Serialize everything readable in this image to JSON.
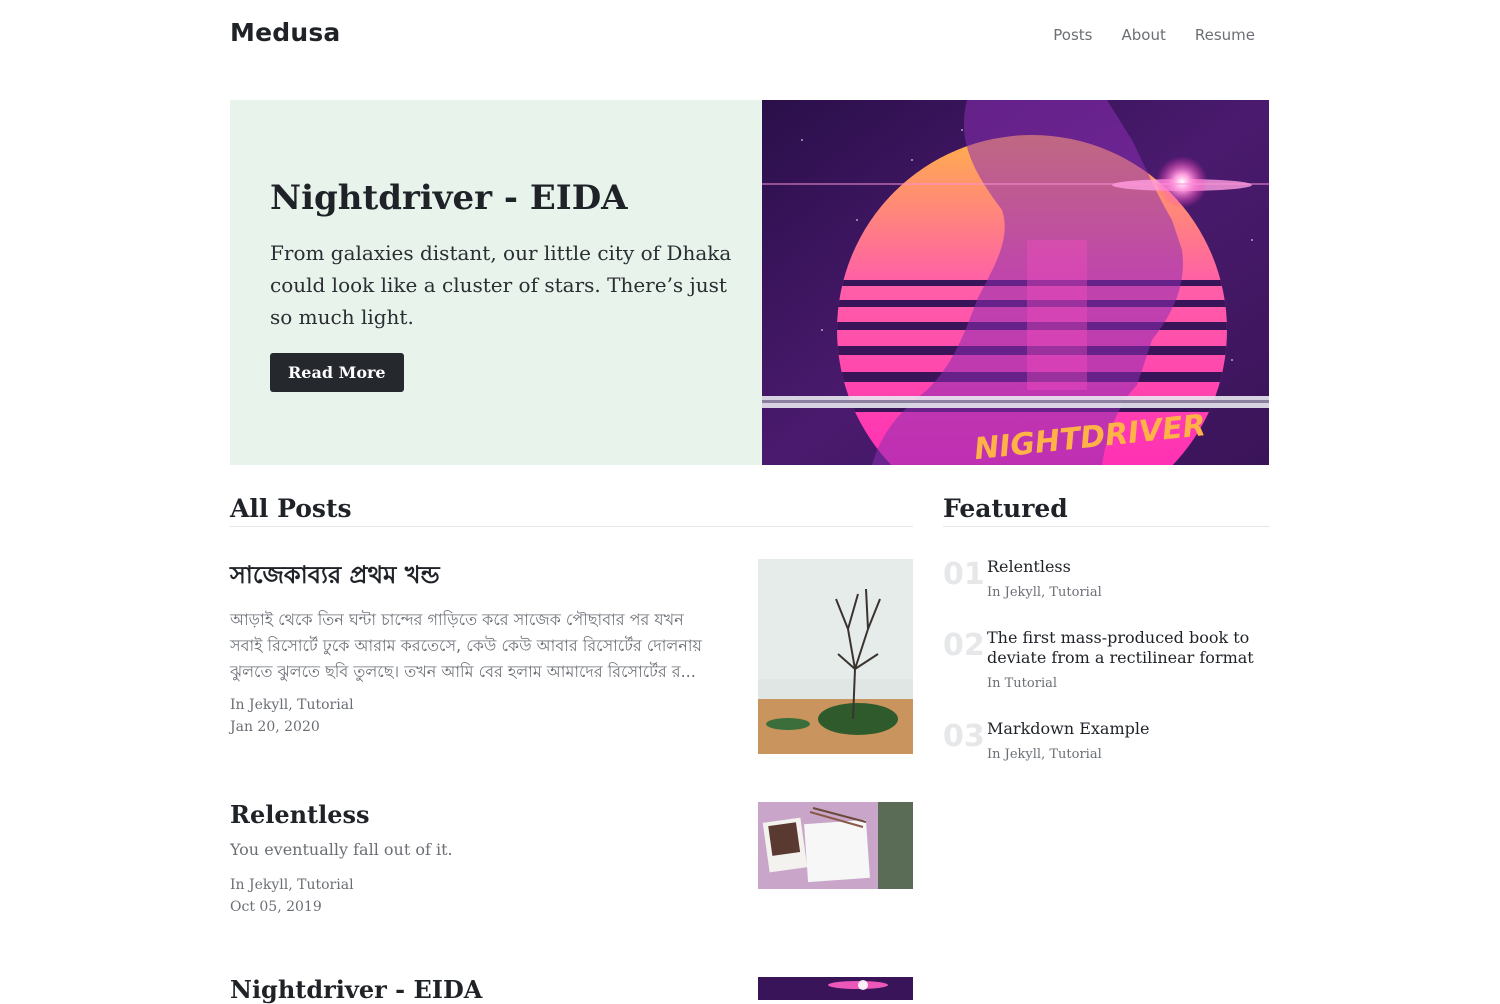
{
  "header": {
    "brand": "Medusa",
    "nav": [
      "Posts",
      "About",
      "Resume"
    ]
  },
  "hero": {
    "title": "Nightdriver - EIDA",
    "excerpt": "From galaxies distant, our little city of Dhaka could look like a cluster of stars. There’s just so much light.",
    "button": "Read More",
    "image_text": "NIGHTDRIVER"
  },
  "all_posts": {
    "heading": "All Posts",
    "posts": [
      {
        "title": "সাজেকাব্যর প্রথম খন্ড",
        "excerpt": "আড়াই থেকে তিন ঘন্টা চান্দের গাড়িতে করে সাজেক পৌছাবার পর যখন সবাই রিসোর্টে ঢুকে আরাম করতেসে, কেউ কেউ আবার রিসোর্টের দোলনায় ঝুলতে ঝুলতে ছবি তুলছে। তখন আমি বের হলাম আমাদের রিসোর্টের র...",
        "categories": "In Jekyll, Tutorial",
        "date": "Jan 20, 2020"
      },
      {
        "title": "Relentless",
        "excerpt": "You eventually fall out of it.",
        "categories": "In Jekyll, Tutorial",
        "date": "Oct 05, 2019"
      },
      {
        "title": "Nightdriver - EIDA"
      }
    ]
  },
  "featured": {
    "heading": "Featured",
    "items": [
      {
        "num": "01",
        "title": "Relentless",
        "categories": "In Jekyll, Tutorial"
      },
      {
        "num": "02",
        "title": "The first mass-produced book to deviate from a rectilinear format",
        "categories": "In Tutorial"
      },
      {
        "num": "03",
        "title": "Markdown Example",
        "categories": "In Jekyll, Tutorial"
      }
    ]
  },
  "colors": {
    "hero_bg": "#e8f3ec",
    "button_bg": "#25292e",
    "neon_pink": "#ff2fb4",
    "sun_orange": "#ff9a3c"
  }
}
